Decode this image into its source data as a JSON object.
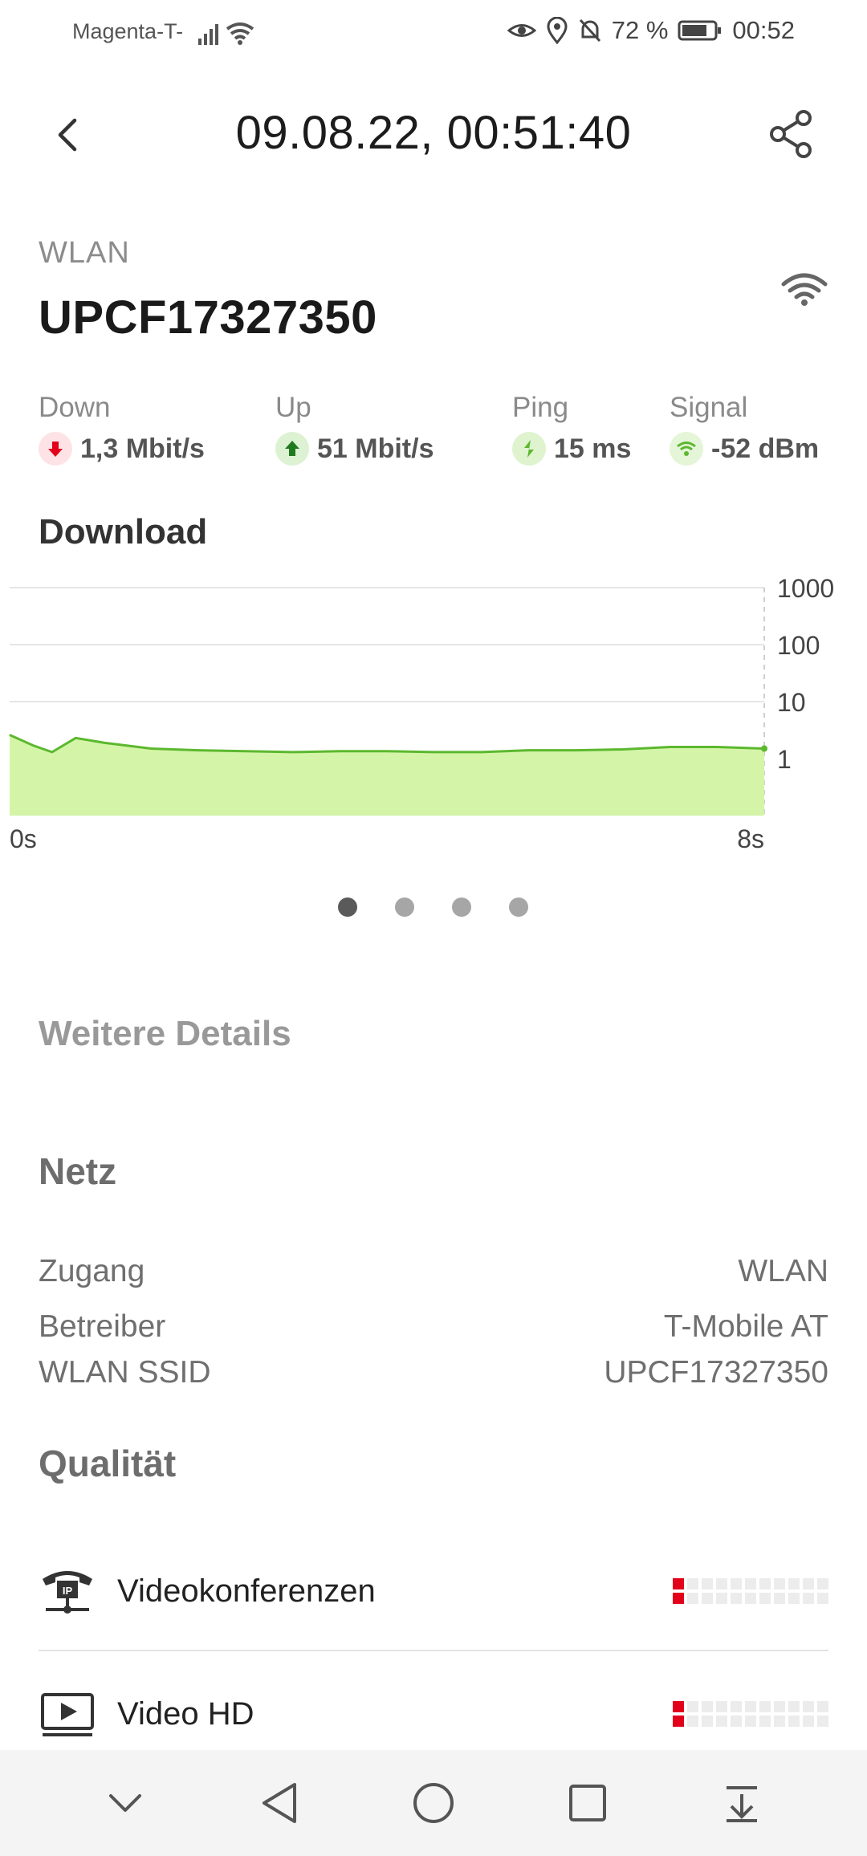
{
  "status_bar": {
    "carrier": "Magenta-T-",
    "battery": "72 %",
    "time": "00:52"
  },
  "header": {
    "title": "09.08.22, 00:51:40"
  },
  "connection": {
    "type": "WLAN",
    "name": "UPCF17327350"
  },
  "metrics": [
    {
      "label": "Down",
      "value": "1,3 Mbit/s",
      "color": "#e2001a"
    },
    {
      "label": "Up",
      "value": "51 Mbit/s",
      "color": "#2d8a2d"
    },
    {
      "label": "Ping",
      "value": "15 ms",
      "color": "#5cb82f"
    },
    {
      "label": "Signal",
      "value": "-52 dBm",
      "color": "#5cb82f"
    }
  ],
  "download_section": {
    "title": "Download"
  },
  "chart_data": {
    "type": "area",
    "y_scale": "log",
    "ylim": [
      0.1,
      1000
    ],
    "y_ticks": [
      "1000",
      "100",
      "10",
      "1"
    ],
    "x_start_label": "0s",
    "x_end_label": "8s",
    "x": [
      0,
      0.25,
      0.45,
      0.7,
      1.0,
      1.5,
      2.0,
      2.5,
      3.0,
      3.5,
      4.0,
      4.5,
      5.0,
      5.5,
      6.0,
      6.5,
      7.0,
      7.5,
      8.0
    ],
    "values": [
      2.6,
      1.7,
      1.3,
      2.3,
      1.9,
      1.5,
      1.4,
      1.35,
      1.3,
      1.35,
      1.35,
      1.3,
      1.3,
      1.4,
      1.4,
      1.45,
      1.6,
      1.6,
      1.5
    ],
    "line_color": "#5cb82f",
    "fill_color": "#d4f5a8"
  },
  "pager": {
    "count": 4,
    "active_index": 0
  },
  "details": {
    "title": "Weitere Details",
    "netz_title": "Netz",
    "rows": [
      {
        "key": "Zugang",
        "value": "WLAN"
      },
      {
        "key": "Betreiber",
        "value": "T-Mobile AT"
      },
      {
        "key": "WLAN SSID",
        "value": "UPCF17327350"
      }
    ]
  },
  "quality": {
    "title": "Qualität",
    "items": [
      {
        "label": "Videokonferenzen",
        "icon": "ip-phone-icon",
        "level": 1,
        "max": 11
      },
      {
        "label": "Video HD",
        "icon": "video-play-icon",
        "level": 1,
        "max": 11
      }
    ],
    "accent": "#e2001a"
  },
  "navbar": {
    "icons": [
      "collapse-icon",
      "back-icon",
      "home-icon",
      "recents-icon",
      "notification-pull-icon"
    ]
  }
}
